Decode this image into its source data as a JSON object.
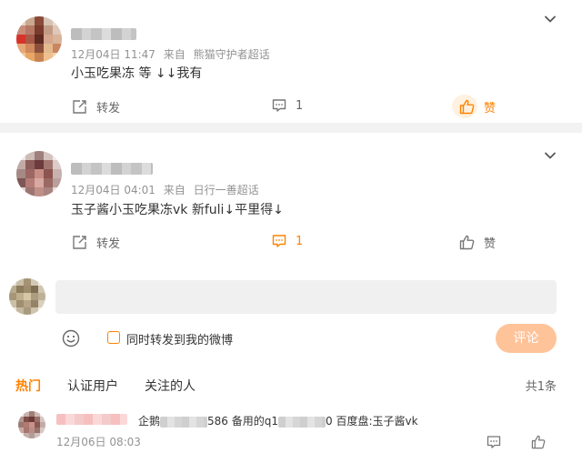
{
  "post1": {
    "time": "12月04日 11:47",
    "source_prefix": "来自",
    "source": "熊猫守护者超话",
    "content": "小玉吃果冻 等 ↓↓我有",
    "repost_label": "转发",
    "comment_count": "1",
    "like_label": "赞"
  },
  "post2": {
    "time": "12月04日 04:01",
    "source_prefix": "来自",
    "source": "日行一善超话",
    "content": "玉子酱小玉吃果冻vk 新fuli↓平里得↓",
    "repost_label": "转发",
    "comment_count": "1",
    "like_label": "赞"
  },
  "comment_box": {
    "input_value": "",
    "forward_checkbox_label": "同时转发到我的微博",
    "forward_checked": false,
    "submit_label": "评论"
  },
  "tabs": [
    {
      "label": "热门",
      "active": true
    },
    {
      "label": "认证用户",
      "active": false
    },
    {
      "label": "关注的人",
      "active": false
    }
  ],
  "total": "共1条",
  "reply": {
    "text_a": "企鹅",
    "text_b": "586 备用的q1",
    "text_c": "0 百度盘:玉子酱vk",
    "time": "12月06日 08:03"
  },
  "colors": {
    "accent": "#ff8200",
    "submit_disabled": "#ffc39a",
    "meta_text": "#939393"
  },
  "icons": [
    "chevron-down-icon",
    "repost-icon",
    "comment-icon",
    "like-icon",
    "emoji-icon"
  ]
}
